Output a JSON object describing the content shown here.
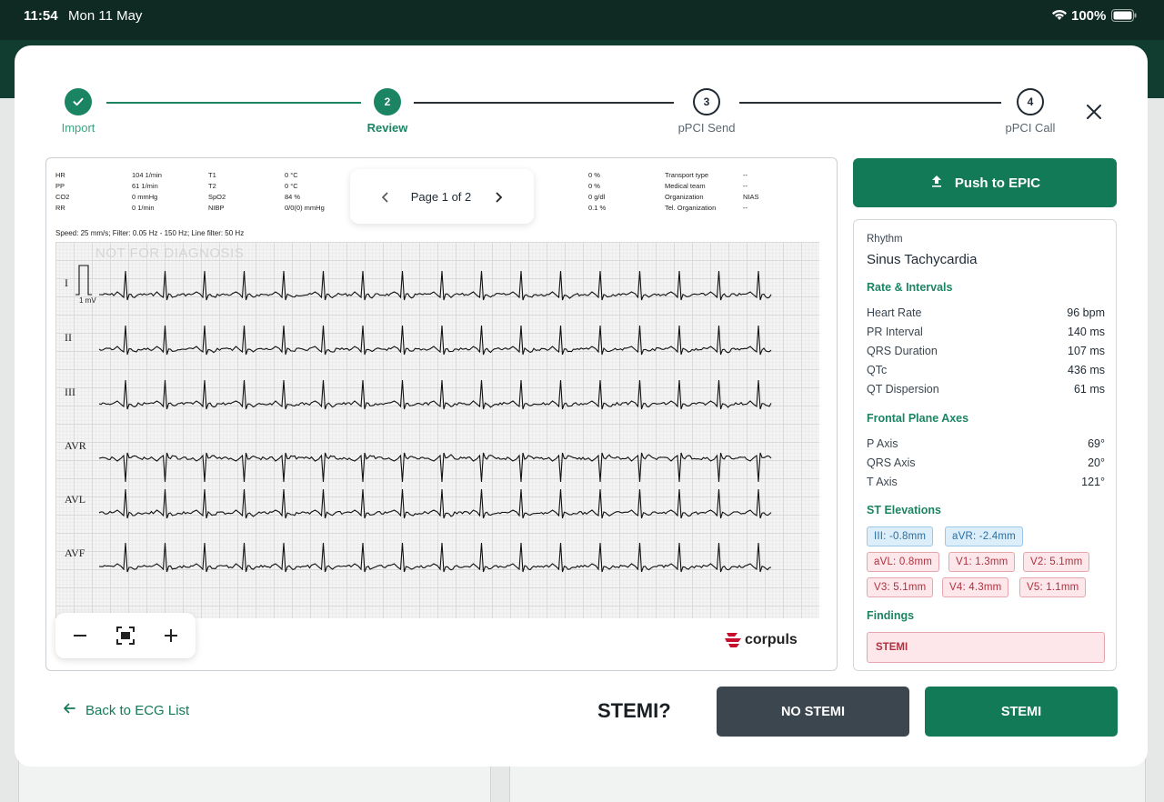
{
  "status_bar": {
    "time": "11:54",
    "date": "Mon 11 May",
    "battery_percent": "100%",
    "icons": [
      "wifi-icon",
      "battery-icon"
    ]
  },
  "stepper": {
    "steps": [
      {
        "number": "✓",
        "label": "Import",
        "state": "done"
      },
      {
        "number": "2",
        "label": "Review",
        "state": "active"
      },
      {
        "number": "3",
        "label": "pPCI Send",
        "state": "pending"
      },
      {
        "number": "4",
        "label": "pPCI Call",
        "state": "pending"
      }
    ]
  },
  "ecg": {
    "meta": [
      {
        "k": "HR",
        "v": "104 1/min"
      },
      {
        "k": "T1",
        "v": "0 °C"
      },
      {
        "k": "PP",
        "v": "61 1/min"
      },
      {
        "k": "T2",
        "v": "0 °C"
      },
      {
        "k": "CO2",
        "v": "0 mmHg"
      },
      {
        "k": "SpO2",
        "v": "84 %"
      },
      {
        "k": "RR",
        "v": "0 1/min"
      },
      {
        "k": "NIBP",
        "v": "0/0(0) mmHg"
      }
    ],
    "meta_right": [
      {
        "k": "Transport type",
        "v": "--"
      },
      {
        "k": "Medical team",
        "v": "--"
      },
      {
        "k": "Organization",
        "v": "NIAS"
      },
      {
        "k": "Tel. Organization",
        "v": "--"
      }
    ],
    "meta_mid": [
      "0 %",
      "0 %",
      "0 g/dl",
      "0.1 %"
    ],
    "speed": "Speed: 25 mm/s; Filter: 0.05 Hz - 150 Hz; Line filter: 50 Hz",
    "watermark": "NOT FOR DIAGNOSIS",
    "mv_label": "1 mV",
    "leads": [
      "I",
      "II",
      "III",
      "AVR",
      "AVL",
      "AVF"
    ],
    "pager": {
      "text": "Page 1 of 2"
    },
    "brand": "corpuls"
  },
  "actions": {
    "push_label": "Push to EPIC",
    "back_label": "Back to ECG List",
    "question": "STEMI?",
    "no_stemi_label": "NO STEMI",
    "stemi_label": "STEMI"
  },
  "info": {
    "rhythm_label": "Rhythm",
    "rhythm_value": "Sinus Tachycardia",
    "rate_title": "Rate & Intervals",
    "rate": [
      {
        "k": "Heart Rate",
        "v": "96 bpm"
      },
      {
        "k": "PR Interval",
        "v": "140 ms"
      },
      {
        "k": "QRS Duration",
        "v": "107 ms"
      },
      {
        "k": "QTc",
        "v": "436 ms"
      },
      {
        "k": "QT Dispersion",
        "v": "61 ms"
      }
    ],
    "axes_title": "Frontal Plane Axes",
    "axes": [
      {
        "k": "P Axis",
        "v": "69°"
      },
      {
        "k": "QRS Axis",
        "v": "20°"
      },
      {
        "k": "T Axis",
        "v": "121°"
      }
    ],
    "st_title": "ST Elevations",
    "st_chips": [
      {
        "text": "III: -0.8mm",
        "color": "blue"
      },
      {
        "text": "aVR: -2.4mm",
        "color": "blue"
      },
      {
        "text": "aVL: 0.8mm",
        "color": "red"
      },
      {
        "text": "V1: 1.3mm",
        "color": "red"
      },
      {
        "text": "V2: 5.1mm",
        "color": "red"
      },
      {
        "text": "V3: 5.1mm",
        "color": "red"
      },
      {
        "text": "V4: 4.3mm",
        "color": "red"
      },
      {
        "text": "V5: 1.1mm",
        "color": "red"
      }
    ],
    "findings_title": "Findings",
    "finding": "STEMI"
  },
  "colors": {
    "brand_green": "#137a57",
    "dark_button": "#3b464f",
    "stemi_red": "#b0303f",
    "st_blue": "#2a6ea0"
  }
}
